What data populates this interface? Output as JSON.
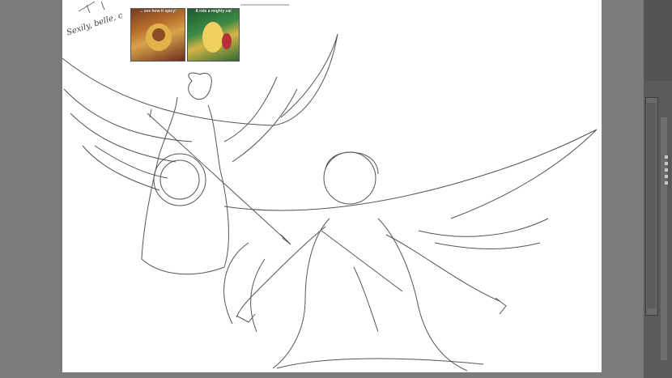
{
  "references": {
    "left_caption": "... see how it spicy!",
    "right_caption": "A ride a mighty val"
  },
  "handwriting": "Sexily, belle, c",
  "colors": {
    "workspace": "#7b7b7b",
    "canvas": "#ffffff",
    "panel": "#5a5a5a"
  },
  "icons": {
    "scroll_thumb": "scrollbar-icon",
    "panel_ticks": "grip-icon"
  }
}
